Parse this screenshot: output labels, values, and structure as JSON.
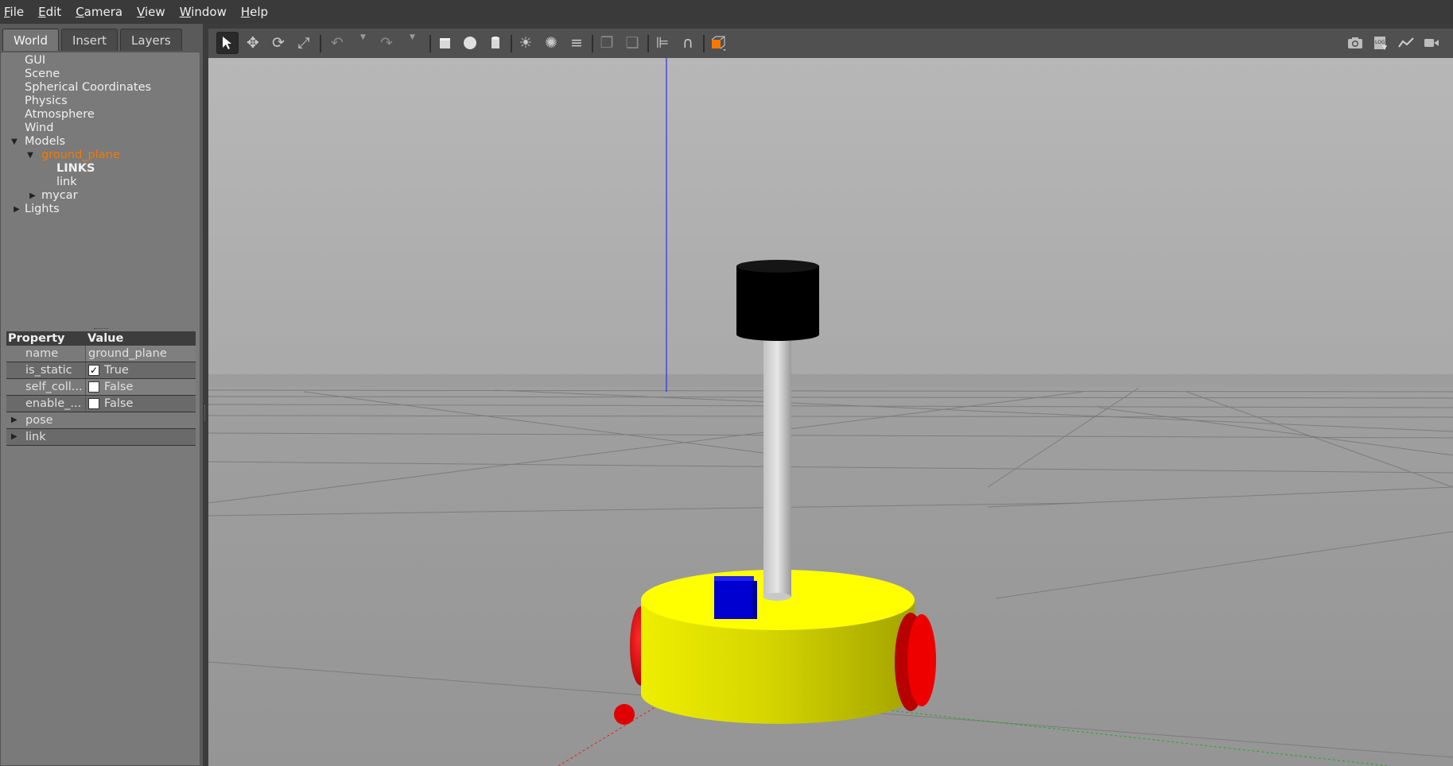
{
  "menu": {
    "items": [
      {
        "first": "F",
        "rest": "ile"
      },
      {
        "first": "E",
        "rest": "dit"
      },
      {
        "first": "C",
        "rest": "amera"
      },
      {
        "first": "V",
        "rest": "iew"
      },
      {
        "first": "W",
        "rest": "indow"
      },
      {
        "first": "H",
        "rest": "elp"
      }
    ]
  },
  "tabs": [
    {
      "label": "World",
      "active": true
    },
    {
      "label": "Insert",
      "active": false
    },
    {
      "label": "Layers",
      "active": false
    }
  ],
  "tree": {
    "gui": "GUI",
    "scene": "Scene",
    "spherical": "Spherical Coordinates",
    "physics": "Physics",
    "atmosphere": "Atmosphere",
    "wind": "Wind",
    "models": "Models",
    "ground_plane": "ground_plane",
    "links": "LINKS",
    "link": "link",
    "mycar": "mycar",
    "lights": "Lights"
  },
  "properties": {
    "header_property": "Property",
    "header_value": "Value",
    "name_key": "name",
    "name_value": "ground_plane",
    "is_static_key": "is_static",
    "is_static_value": "True",
    "self_collide_key": "self_coll...",
    "self_collide_value": "False",
    "enable_key": "enable_...",
    "enable_value": "False",
    "pose": "pose",
    "link": "link"
  },
  "toolbar": {
    "icons": [
      "select-arrow-icon",
      "translate-icon",
      "rotate-icon",
      "scale-icon",
      "undo-icon",
      "redo-icon",
      "box-icon",
      "sphere-icon",
      "cylinder-icon",
      "point-light-icon",
      "spot-light-icon",
      "directional-light-icon",
      "copy-icon",
      "paste-icon",
      "align-icon",
      "snap-magnet-icon",
      "view-angle-icon",
      "screenshot-icon",
      "log-icon",
      "plot-icon",
      "record-video-icon"
    ]
  },
  "colors": {
    "selection": "#f57900",
    "robot_body": "#e6e600",
    "wheels": "#e00000",
    "sensor": "#0000d0",
    "camera_head": "#000000",
    "sky": "#b3b3b3",
    "ground": "#9c9c9c"
  }
}
